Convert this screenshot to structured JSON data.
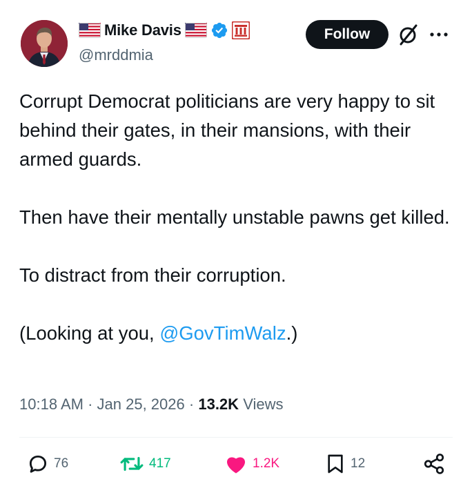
{
  "author": {
    "display_name": "Mike Davis",
    "handle": "@mrddmia",
    "verified": true,
    "badge_icons": [
      "us-flag-icon",
      "us-flag-icon",
      "verified-badge-icon",
      "affiliate-badge-icon"
    ]
  },
  "header": {
    "follow_label": "Follow",
    "grok_icon": "grok-icon",
    "more_icon": "more-options-icon"
  },
  "tweet": {
    "paragraphs": [
      "Corrupt Democrat politicians are very happy to sit behind their gates, in their mansions, with their armed guards.",
      "Then have their mentally unstable pawns get killed.",
      "To distract from their corruption."
    ],
    "last_paragraph_prefix": "(Looking at you, ",
    "mention": "@GovTimWalz",
    "last_paragraph_suffix": ".)"
  },
  "meta": {
    "time": "10:18 AM",
    "separator": "·",
    "date": "Jan 25, 2026",
    "views_count": "13.2K",
    "views_label": "Views"
  },
  "actions": {
    "replies": "76",
    "reposts": "417",
    "likes": "1.2K",
    "bookmarks": "12"
  },
  "colors": {
    "text": "#0f1419",
    "secondary": "#536471",
    "link": "#1d9bf0",
    "repost": "#00ba7c",
    "like": "#f91880",
    "verified": "#1d9bf0"
  }
}
